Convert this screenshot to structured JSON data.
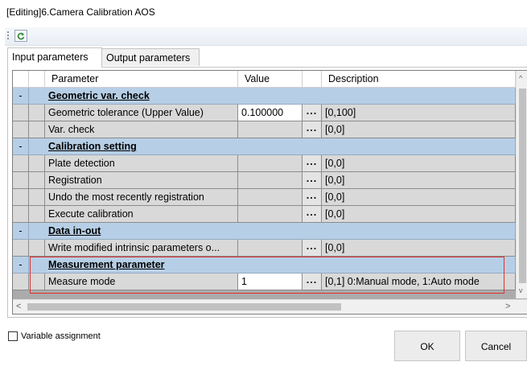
{
  "window": {
    "title": "[Editing]6.Camera Calibration AOS"
  },
  "toolbar": {
    "refresh_icon": "refresh-icon"
  },
  "tabs": [
    {
      "label": "Input parameters",
      "active": true
    },
    {
      "label": "Output parameters",
      "active": false
    }
  ],
  "grid": {
    "headers": {
      "parameter": "Parameter",
      "value": "Value",
      "description": "Description"
    },
    "collapse_symbol": "-",
    "ellipsis": "...",
    "groups": [
      {
        "label": "Geometric var. check"
      },
      {
        "label": "Calibration setting"
      },
      {
        "label": "Data in-out"
      },
      {
        "label": "Measurement parameter"
      }
    ],
    "rows": [
      {
        "param": "Geometric tolerance (Upper Value)",
        "value": "0.100000",
        "desc": "[0,100]"
      },
      {
        "param": "Var. check",
        "value": "",
        "desc": "[0,0]"
      },
      {
        "param": "Plate detection",
        "value": "",
        "desc": "[0,0]"
      },
      {
        "param": "Registration",
        "value": "",
        "desc": "[0,0]"
      },
      {
        "param": "Undo the most recently registration",
        "value": "",
        "desc": "[0,0]"
      },
      {
        "param": "Execute calibration",
        "value": "",
        "desc": "[0,0]"
      },
      {
        "param": "Write modified intrinsic parameters o...",
        "value": "",
        "desc": "[0,0]"
      },
      {
        "param": "Measure mode",
        "value": "1",
        "desc": "[0,1] 0:Manual mode, 1:Auto mode"
      }
    ]
  },
  "footer": {
    "variable_assignment_label": "Variable assignment",
    "variable_assignment_checked": false,
    "ok_label": "OK",
    "cancel_label": "Cancel"
  },
  "colors": {
    "group_row": "#b7cfe6",
    "item_row": "#d9d9d9",
    "highlight": "#e03030"
  }
}
